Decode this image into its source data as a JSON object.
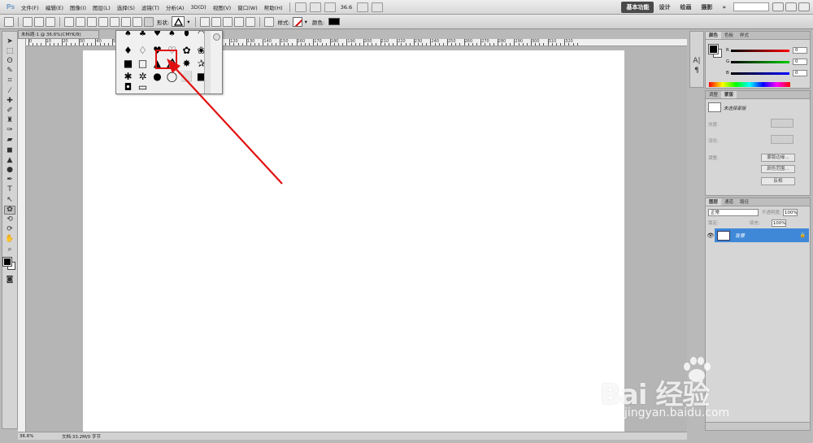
{
  "menubar": {
    "logo": "Ps",
    "items": [
      "文件(F)",
      "编辑(E)",
      "图像(I)",
      "图层(L)",
      "选择(S)",
      "滤镜(T)",
      "分析(A)",
      "3D(D)",
      "视图(V)",
      "窗口(W)",
      "帮助(H)"
    ],
    "zoom": "36.6",
    "workspaces": [
      "基本功能",
      "设计",
      "绘画",
      "摄影"
    ],
    "more": "»"
  },
  "options": {
    "shape_label": "形状:",
    "style_label": "样式:",
    "color_label": "颜色:",
    "color_value": "#000000"
  },
  "document": {
    "tab_title": "未标题-1 @ 36.6%(CMYK/8)",
    "ruler_top_numbers": [
      "0",
      "10",
      "20",
      "30",
      "40",
      "50",
      "60",
      "70",
      "80",
      "90",
      "100",
      "110",
      "120",
      "130",
      "140",
      "150",
      "160",
      "170",
      "180",
      "190",
      "200",
      "210",
      "220",
      "230",
      "240",
      "250",
      "260",
      "270",
      "280",
      "290",
      "300",
      "310",
      "320"
    ],
    "status_zoom": "36.6%",
    "status_doc": "文档:33.2M/0 字节"
  },
  "panels": {
    "color_tabs": [
      "颜色",
      "色板",
      "样式"
    ],
    "channels": [
      {
        "name": "R",
        "value": "0",
        "color": "#e00000"
      },
      {
        "name": "G",
        "value": "0",
        "color": "#00a000"
      },
      {
        "name": "B",
        "value": "0",
        "color": "#0000d0"
      }
    ],
    "mask_tabs": [
      "调整",
      "蒙版"
    ],
    "mask_title": "未选择蒙版",
    "mask_labels": [
      "浓度:",
      "羽化:",
      "调整:"
    ],
    "mask_buttons": [
      "蒙版边缘...",
      "颜色范围...",
      "反相"
    ],
    "layers_tabs": [
      "图层",
      "通道",
      "路径"
    ],
    "blend_mode": "正常",
    "opacity_label": "不透明度:",
    "opacity": "100%",
    "lock_label": "锁定:",
    "fill_label": "填充:",
    "fill": "100%",
    "layer_name": "背景"
  },
  "watermark": {
    "text": "Bai 经验",
    "sub": "jingyan.baidu.com"
  },
  "colors": {
    "highlight": "#e01010",
    "layer_selected": "#3f88d8"
  }
}
